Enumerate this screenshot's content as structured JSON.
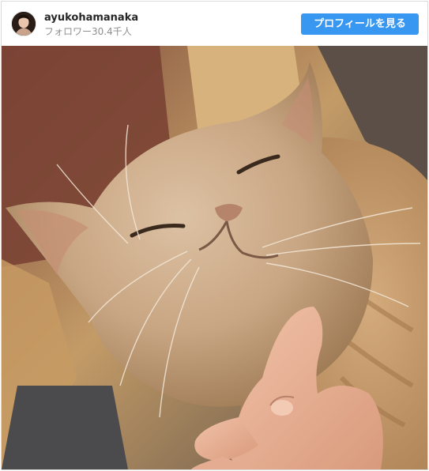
{
  "post": {
    "username": "ayukohamanaka",
    "followers": "フォロワー30.4千人",
    "profile_button_label": "プロフィールを見る"
  },
  "photo": {
    "subject": "cat-being-scratched-under-chin"
  },
  "colors": {
    "button": "#3897f0",
    "username": "#262626",
    "secondary_text": "#8e8e8e",
    "border": "#dbdbdb"
  }
}
